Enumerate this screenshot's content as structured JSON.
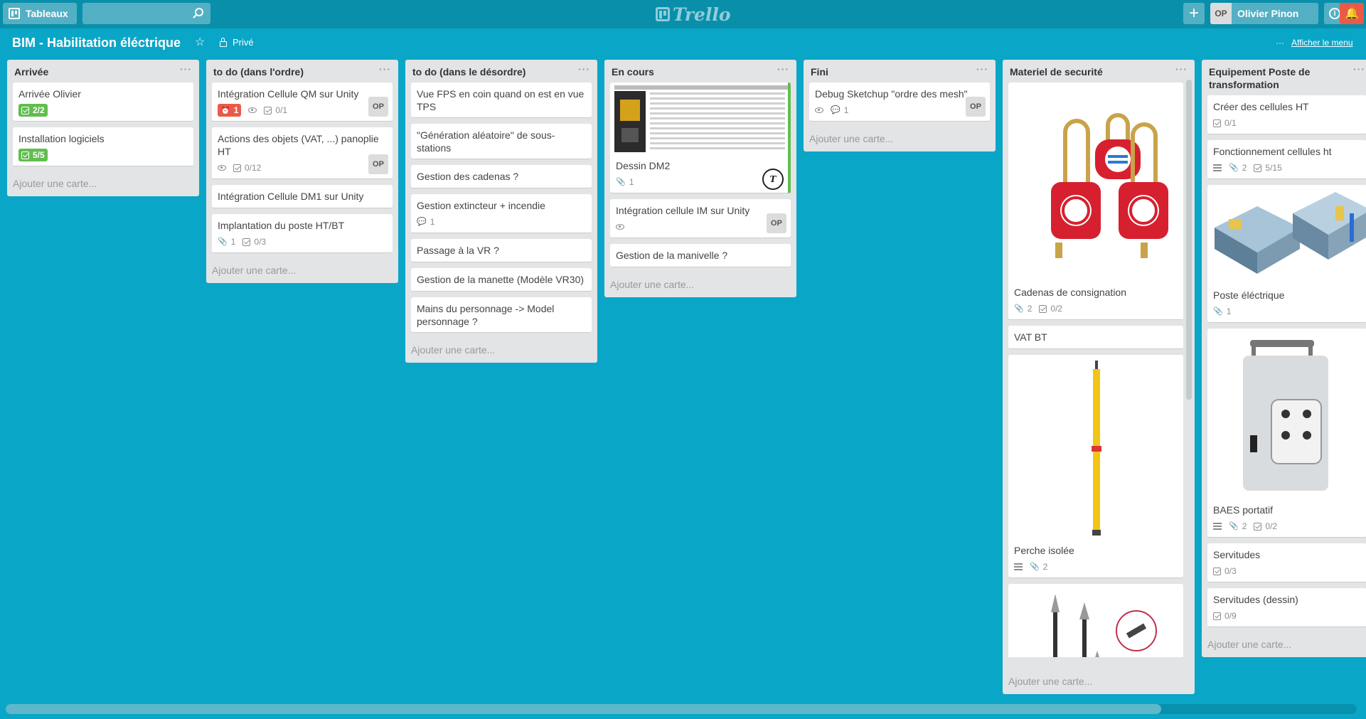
{
  "header": {
    "boards_label": "Tableaux",
    "search_placeholder": "",
    "logo_text": "Trello",
    "user_initials": "OP",
    "user_name": "Olivier Pinon"
  },
  "board": {
    "title": "BIM - Habilitation éléctrique",
    "visibility": "Privé",
    "menu_label": "Afficher le menu"
  },
  "add_card_label": "Ajouter une carte...",
  "lists": [
    {
      "title": "Arrivée",
      "cards": [
        {
          "title": "Arrivée Olivier",
          "checklist": "2/2"
        },
        {
          "title": "Installation logiciels",
          "checklist": "5/5"
        }
      ]
    },
    {
      "title": "to do (dans l'ordre)",
      "cards": [
        {
          "title": "Intégration Cellule QM sur Unity",
          "due": "1",
          "checklist": "0/1",
          "member": "OP"
        },
        {
          "title": "Actions des objets (VAT, ...) panoplie HT",
          "checklist": "0/12",
          "member": "OP"
        },
        {
          "title": "Intégration Cellule DM1 sur Unity"
        },
        {
          "title": "Implantation du poste HT/BT",
          "attachments": "1",
          "checklist": "0/3"
        }
      ]
    },
    {
      "title": "to do (dans le désordre)",
      "cards": [
        {
          "title": "Vue FPS en coin quand on est en vue TPS"
        },
        {
          "title": "\"Génération aléatoire\" de sous-stations"
        },
        {
          "title": "Gestion des cadenas ?"
        },
        {
          "title": "Gestion extincteur + incendie",
          "comments": "1"
        },
        {
          "title": "Passage à la VR ?"
        },
        {
          "title": "Gestion de la manette (Modèle VR30)"
        },
        {
          "title": "Mains du personnage -> Model personnage ?"
        }
      ]
    },
    {
      "title": "En cours",
      "cards": [
        {
          "title": "Dessin DM2",
          "attachments": "1"
        },
        {
          "title": "Intégration cellule IM sur Unity",
          "member": "OP"
        },
        {
          "title": "Gestion de la manivelle ?"
        }
      ]
    },
    {
      "title": "Fini",
      "cards": [
        {
          "title": "Debug Sketchup \"ordre des mesh\"",
          "comments": "1",
          "member": "OP"
        }
      ]
    },
    {
      "title": "Materiel de securité",
      "cards": [
        {
          "title": "Cadenas de consignation",
          "attachments": "2",
          "checklist": "0/2"
        },
        {
          "title": "VAT BT"
        },
        {
          "title": "Perche isolée",
          "attachments": "2"
        }
      ]
    },
    {
      "title": "Equipement Poste de transformation",
      "cards": [
        {
          "title": "Créer des cellules HT",
          "checklist": "0/1"
        },
        {
          "title": "Fonctionnement cellules ht",
          "attachments": "2",
          "checklist": "5/15"
        },
        {
          "title": "Poste éléctrique",
          "attachments": "1"
        },
        {
          "title": "BAES portatif",
          "attachments": "2",
          "checklist": "0/2"
        },
        {
          "title": "Servitudes",
          "checklist": "0/3"
        },
        {
          "title": "Servitudes (dessin)",
          "checklist": "0/9"
        }
      ]
    }
  ],
  "colors": {
    "background": "#0aa6c7",
    "header": "#0a8fab",
    "label_green": "#61bd4f",
    "label_red": "#eb5a46"
  }
}
